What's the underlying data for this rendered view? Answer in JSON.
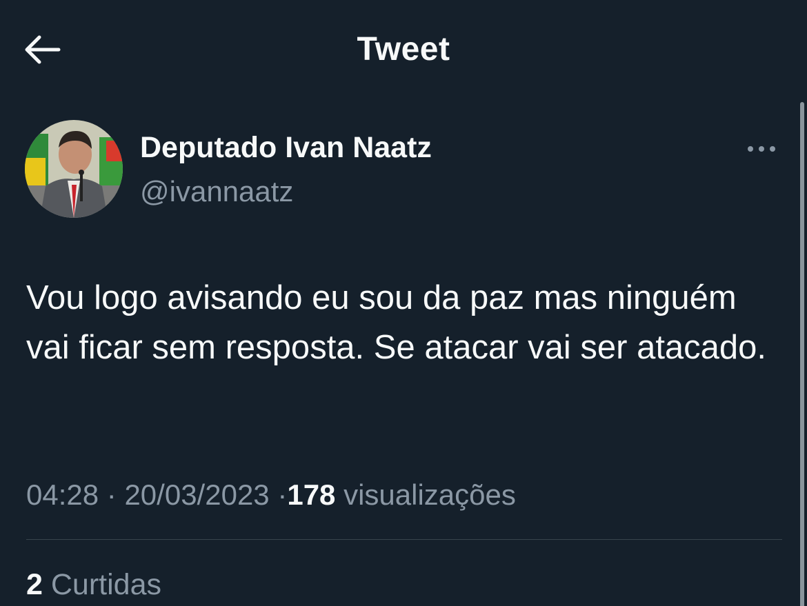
{
  "header": {
    "title": "Tweet",
    "back_icon": "arrow-left-icon"
  },
  "tweet": {
    "author": {
      "name": "Deputado Ivan Naatz",
      "handle": "@ivannaatz",
      "avatar_icon": "profile-photo"
    },
    "more_icon": "more-horizontal-icon",
    "text": "Vou logo avisando eu sou da paz mas ninguém vai ficar sem resposta. Se atacar vai ser atacado.",
    "time": "04:28",
    "separator": "·",
    "date": "20/03/2023",
    "views_count": "178",
    "views_label": "visualizações",
    "likes_count": "2",
    "likes_label": "Curtidas"
  },
  "colors": {
    "background": "#15202b",
    "text_primary": "#f7f9f9",
    "text_secondary": "#8b98a5",
    "divider": "#38444d"
  }
}
